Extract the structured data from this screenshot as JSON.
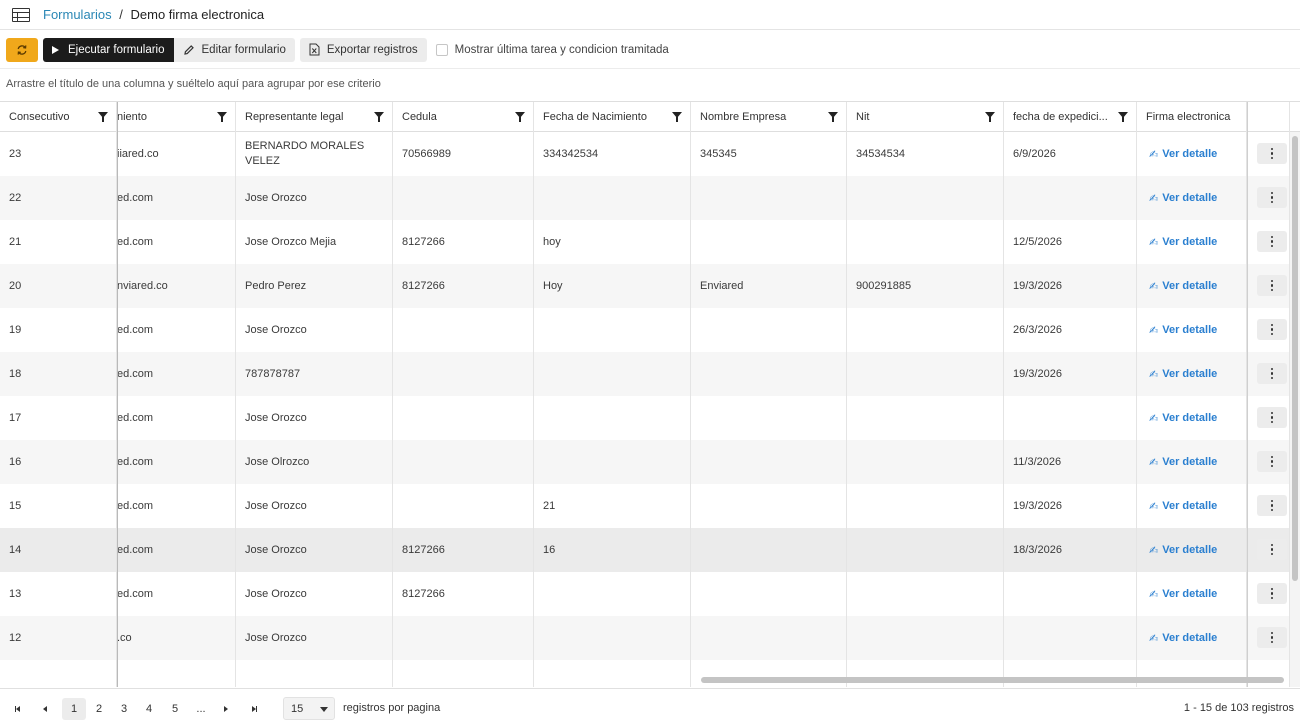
{
  "header": {
    "breadcrumb_link": "Formularios",
    "separator": "/",
    "title": "Demo firma electronica"
  },
  "toolbar": {
    "run_label": "Ejecutar formulario",
    "edit_label": "Editar formulario",
    "export_label": "Exportar registros",
    "checkbox_label": "Mostrar última tarea y condicion tramitada",
    "refresh_color": "#f0a81b"
  },
  "group_panel": {
    "text": "Arrastre el título de una columna y suéltelo aquí para agrupar por ese criterio"
  },
  "columns": [
    "Consecutivo",
    "niento",
    "Representante legal",
    "Cedula",
    "Fecha de Nacimiento",
    "Nombre Empresa",
    "Nit",
    "fecha de expedici...",
    "Firma electronica"
  ],
  "link_label": "Ver detalle",
  "rows": [
    [
      "23",
      "iiared.co",
      "BERNARDO MORALES VELEZ",
      "70566989",
      "334342534",
      "345345",
      "34534534",
      "6/9/2026"
    ],
    [
      "22",
      "ed.com",
      "Jose Orozco",
      "",
      "",
      "",
      "",
      ""
    ],
    [
      "21",
      "ed.com",
      "Jose Orozco Mejia",
      "8127266",
      "hoy",
      "",
      "",
      "12/5/2026"
    ],
    [
      "20",
      "nviared.co",
      "Pedro Perez",
      "8127266",
      "Hoy",
      "Enviared",
      "900291885",
      "19/3/2026"
    ],
    [
      "19",
      "ed.com",
      "Jose Orozco",
      "",
      "",
      "",
      "",
      "26/3/2026"
    ],
    [
      "18",
      "ed.com",
      "787878787",
      "",
      "",
      "",
      "",
      "19/3/2026"
    ],
    [
      "17",
      "ed.com",
      "Jose Orozco",
      "",
      "",
      "",
      "",
      ""
    ],
    [
      "16",
      "ed.com",
      "Jose Olrozco",
      "",
      "",
      "",
      "",
      "11/3/2026"
    ],
    [
      "15",
      "ed.com",
      "Jose Orozco",
      "",
      "21",
      "",
      "",
      "19/3/2026"
    ],
    [
      "14",
      "ed.com",
      "Jose Orozco",
      "8127266",
      "16",
      "",
      "",
      "18/3/2026"
    ],
    [
      "13",
      "ed.com",
      "Jose Orozco",
      "8127266",
      "",
      "",
      "",
      ""
    ],
    [
      "12",
      ".co",
      "Jose Orozco",
      "",
      "",
      "",
      "",
      ""
    ]
  ],
  "pager": {
    "pages": [
      "1",
      "2",
      "3",
      "4",
      "5",
      "..."
    ],
    "page_size": "15",
    "per_page_label": "registros por pagina",
    "info": "1 - 15 de 103 registros"
  }
}
